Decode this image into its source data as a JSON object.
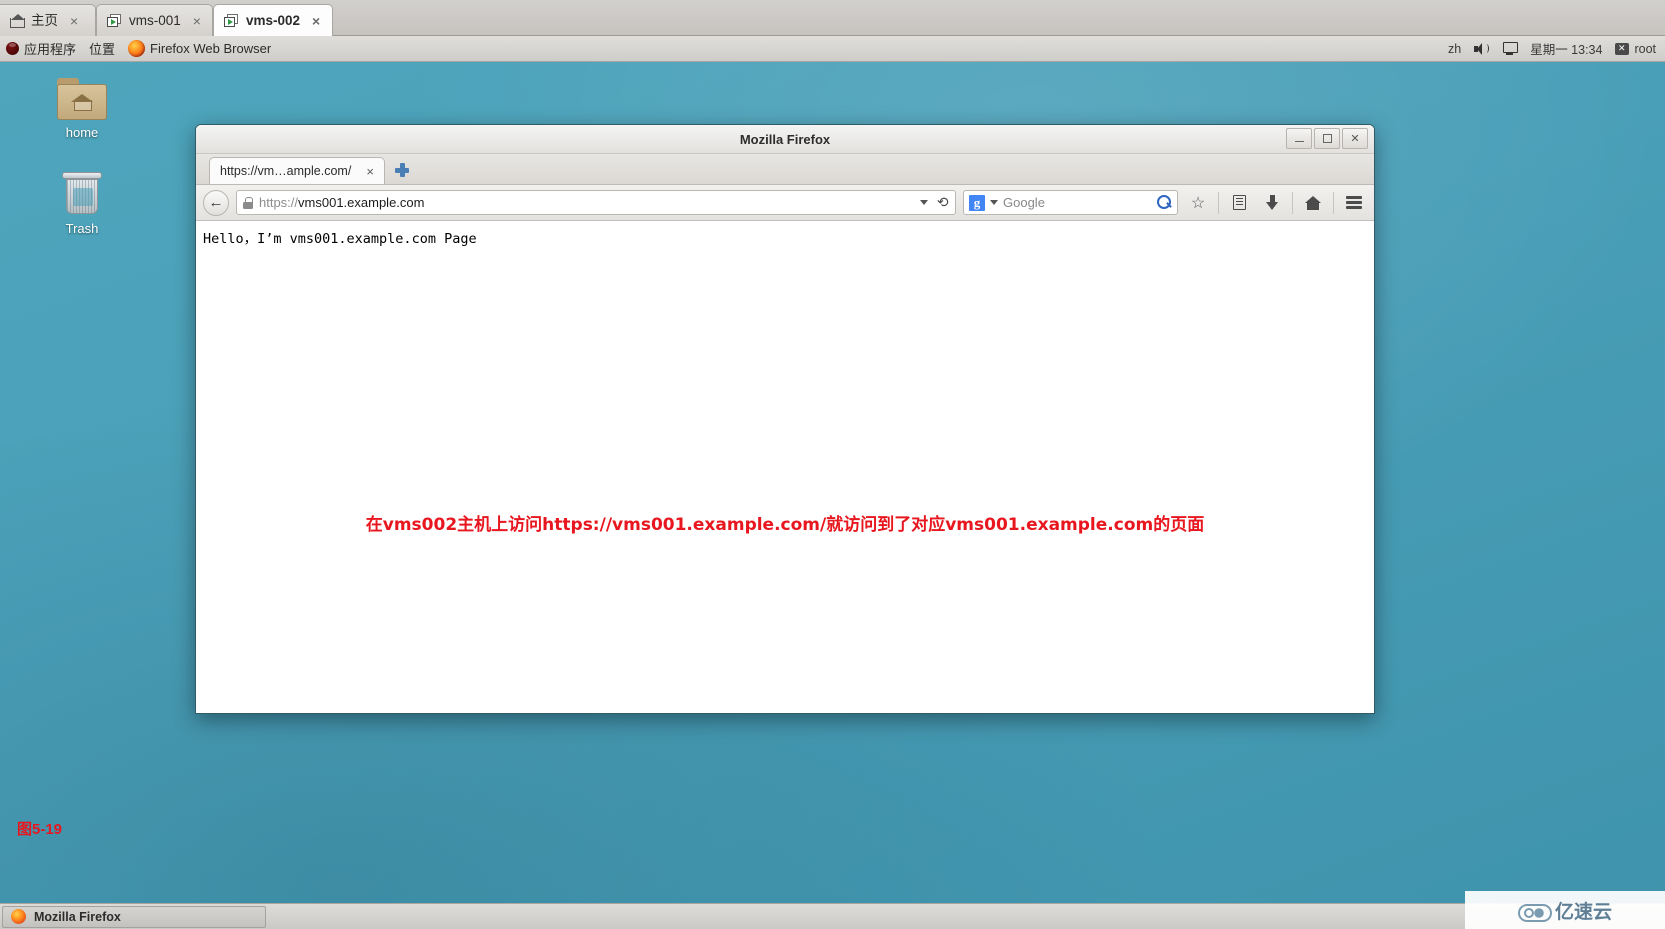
{
  "host_tabs": [
    {
      "label": "主页",
      "icon": "home-icon",
      "active": false,
      "close": "×"
    },
    {
      "label": "vms-001",
      "icon": "vm-console-icon",
      "active": false,
      "close": "×"
    },
    {
      "label": "vms-002",
      "icon": "vm-console-icon",
      "active": true,
      "close": "×"
    }
  ],
  "panel": {
    "applications": "应用程序",
    "places": "位置",
    "window_title": "Firefox Web Browser",
    "keyboard_layout": "zh",
    "datetime": "星期一 13:34",
    "user": "root"
  },
  "desktop_icons": [
    {
      "label": "home",
      "icon": "folder-home-icon"
    },
    {
      "label": "Trash",
      "icon": "trash-icon"
    }
  ],
  "firefox": {
    "window_title": "Mozilla Firefox",
    "window_buttons": {
      "minimize": "_",
      "maximize": "□",
      "close": "✕"
    },
    "tab": {
      "title": "https://vm…ample.com/",
      "close": "×"
    },
    "new_tab_tooltip": "+",
    "urlbar": {
      "scheme_text": "https://",
      "host_text": "vms001.example.com",
      "full_value": "https://vms001.example.com",
      "lock": "lock-icon",
      "dropdown": "▾",
      "reload": "⟳"
    },
    "searchbar": {
      "engine": "Google",
      "engine_logo_letter": "g",
      "placeholder": "Google",
      "dropdown": "▾"
    },
    "toolbar_icons": [
      "bookmark-star-icon",
      "library-icon",
      "downloads-icon",
      "home-icon",
      "menu-icon"
    ],
    "page": {
      "body_text": "Hello，I’m vms001.example.com Page",
      "annotation": "在vms002主机上访问https://vms001.example.com/就访问到了对应vms001.example.com的页面"
    }
  },
  "figure_caption": "图5-19",
  "taskbar": {
    "window_button": "Mozilla Firefox"
  },
  "watermark": {
    "text": "亿速云",
    "icon": "cloud-icon"
  },
  "colors": {
    "desktop": "#4a9fb8",
    "annotation_red": "#e8171f",
    "accent_blue": "#4285f4"
  }
}
